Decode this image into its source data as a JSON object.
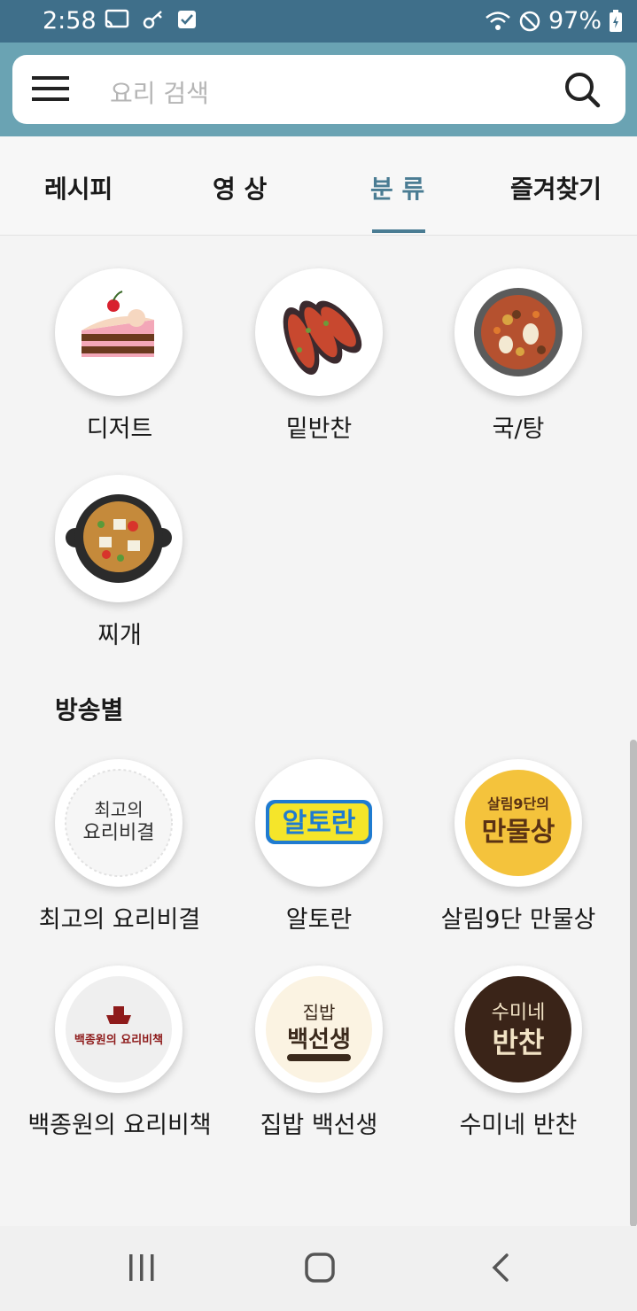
{
  "status": {
    "time": "2:58",
    "battery": "97%"
  },
  "search": {
    "placeholder": "요리 검색"
  },
  "tabs": [
    {
      "label": "레시피"
    },
    {
      "label": "영 상"
    },
    {
      "label": "분 류"
    },
    {
      "label": "즐겨찾기"
    }
  ],
  "categories": [
    {
      "label": "디저트",
      "icon": "cake-icon"
    },
    {
      "label": "밑반찬",
      "icon": "side-dish-icon"
    },
    {
      "label": "국/탕",
      "icon": "soup-icon"
    },
    {
      "label": "찌개",
      "icon": "stew-icon"
    }
  ],
  "section": {
    "title": "방송별"
  },
  "shows": [
    {
      "label": "최고의 요리비결",
      "logo": "최고의 요리비결"
    },
    {
      "label": "알토란",
      "logo": "알토란"
    },
    {
      "label": "살림9단 만물상",
      "logo": "살림9단의 만물상"
    },
    {
      "label": "백종원의 요리비책",
      "logo": "백종원의 요리비책"
    },
    {
      "label": "집밥 백선생",
      "logo": "집밥 백선생"
    },
    {
      "label": "수미네 반찬",
      "logo": "수미네 반찬"
    }
  ],
  "colors": {
    "accent": "#4a7c93",
    "statusbar": "#3f6f8a",
    "searchband": "#6aa3b3"
  }
}
